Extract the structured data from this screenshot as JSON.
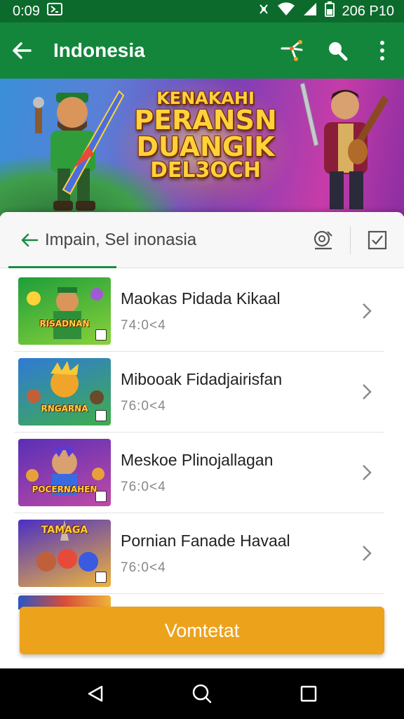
{
  "status_bar": {
    "time": "0:09",
    "right_text": "206 P10"
  },
  "app_bar": {
    "title": "Indonesia"
  },
  "banner": {
    "line1": "KENAKAHI",
    "line2": "PERANSN",
    "line3": "DUANGIK",
    "line4": "DEL3OCH"
  },
  "tabs": {
    "title": "Impain, Sel inonasia"
  },
  "games": [
    {
      "title": "Maokas Pidada Kikaal",
      "subtitle": "74:0<4",
      "thumb_text": "RISADNAN",
      "thumb_colors": [
        "#1e9e3a",
        "#8ad23a"
      ]
    },
    {
      "title": "Mibooak Fidadjairisfan",
      "subtitle": "76:0<4",
      "thumb_text": "RNGARNA",
      "thumb_colors": [
        "#2f7ad6",
        "#3fae4a"
      ]
    },
    {
      "title": "Meskoe Plinojallagan",
      "subtitle": "76:0<4",
      "thumb_text": "POCERNAHEN",
      "thumb_colors": [
        "#5a2fb6",
        "#c04aa6"
      ]
    },
    {
      "title": "Pornian Fanade Havaal",
      "subtitle": "76:0<4",
      "thumb_text": "TAMAGA",
      "thumb_colors": [
        "#4a2fc6",
        "#f0b43a"
      ]
    }
  ],
  "cta": {
    "label": "Vomtetat"
  }
}
